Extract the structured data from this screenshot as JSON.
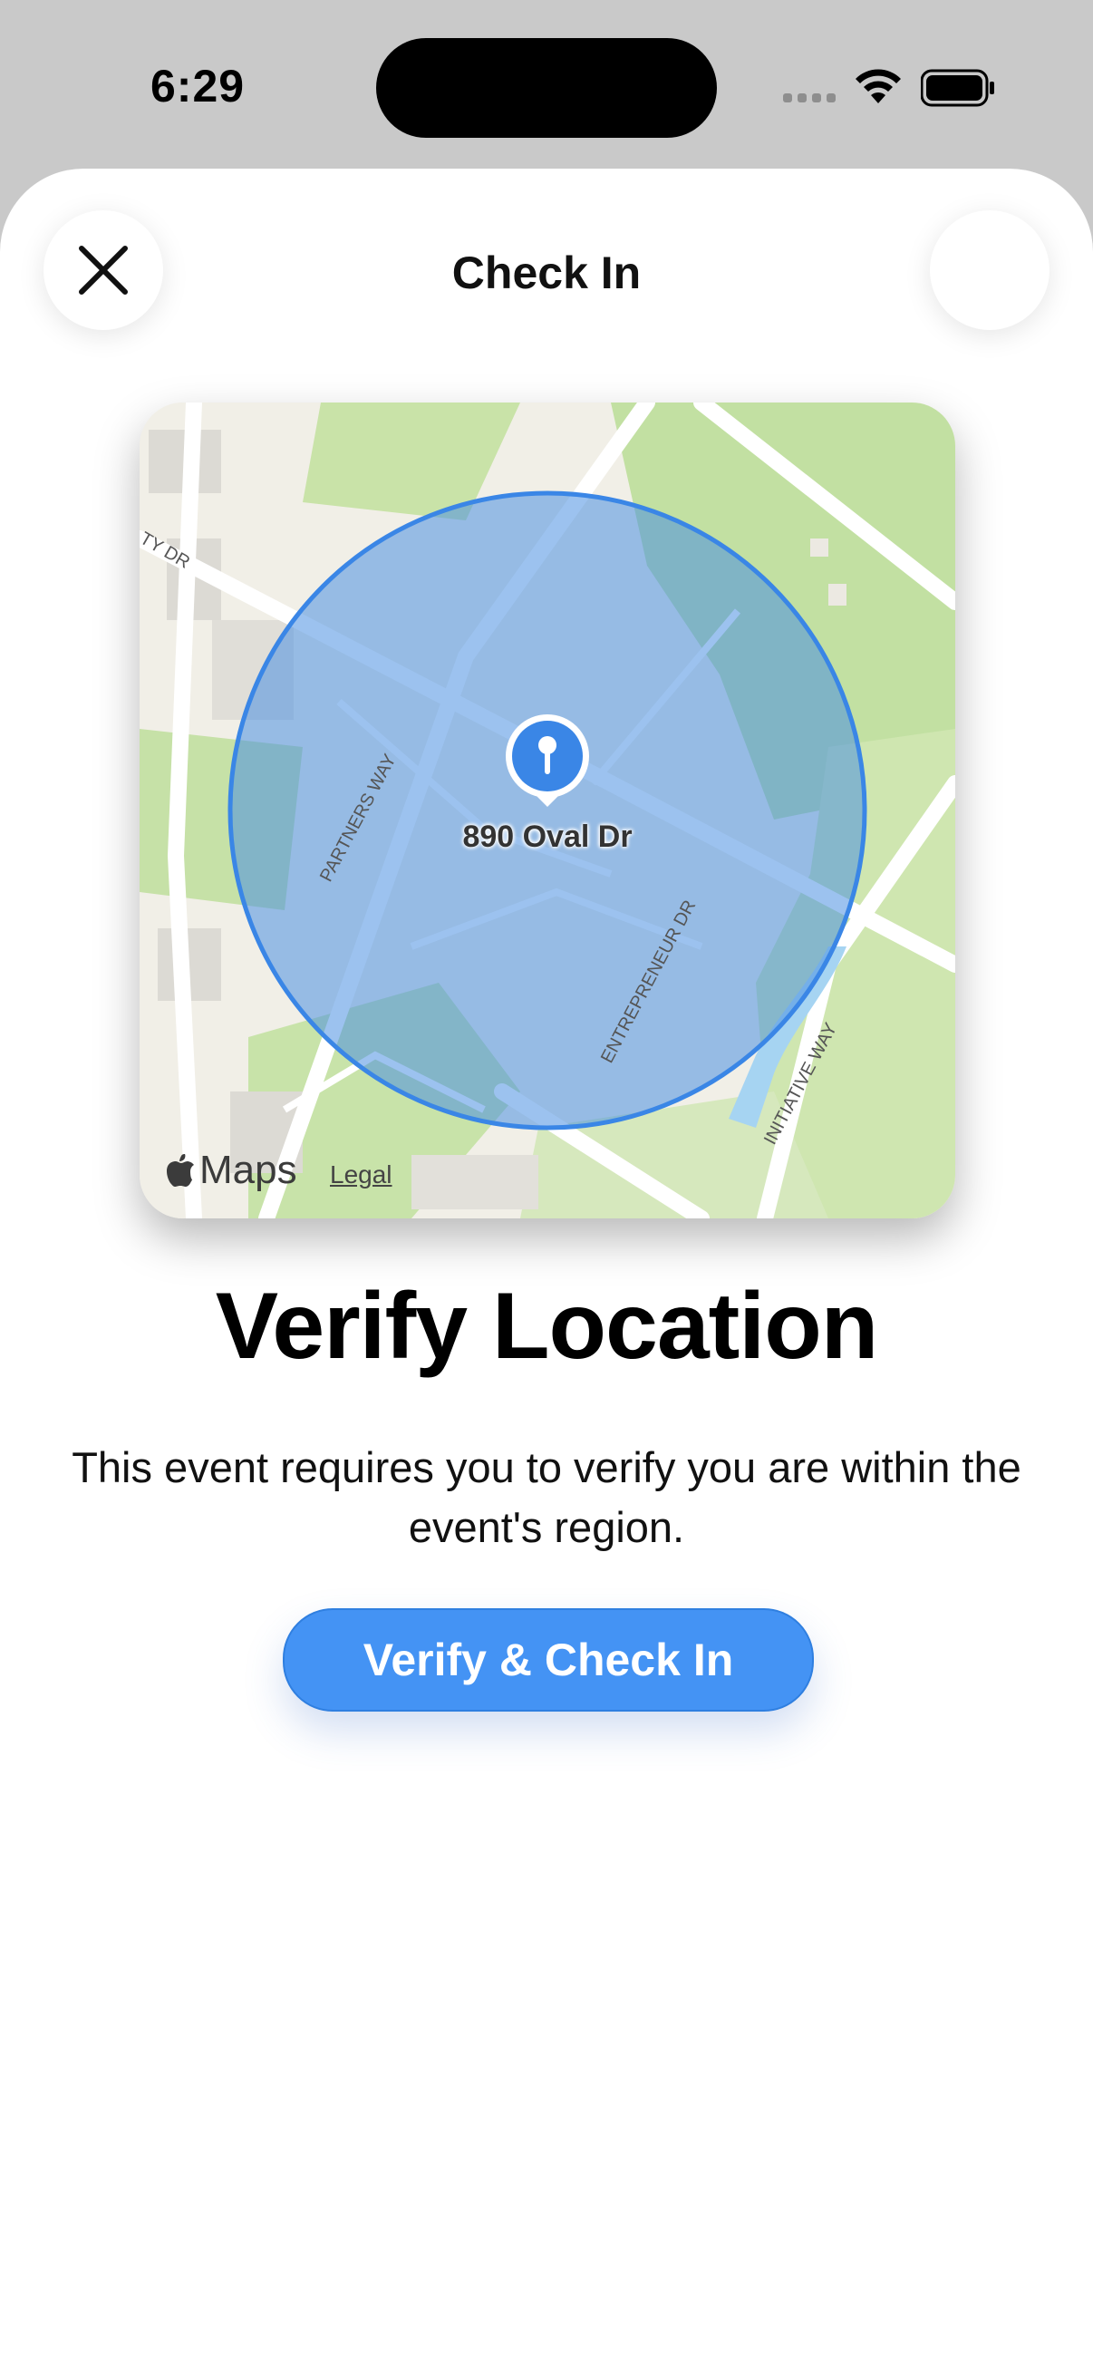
{
  "status_bar": {
    "time": "6:29",
    "icons": [
      "cellular-signal-icon",
      "wifi-icon",
      "battery-icon"
    ]
  },
  "nav": {
    "title": "Check In",
    "close_icon": "close-icon"
  },
  "map": {
    "pin_label": "890 Oval Dr",
    "street_labels": [
      "TY DR",
      "PARTNERS WAY",
      "ENTREPRENEUR DR",
      "INITIATIVE WAY"
    ],
    "attribution": "Maps",
    "legal_link": "Legal",
    "region_color": "#4a90e2"
  },
  "content": {
    "title": "Verify Location",
    "description": "This event requires you to verify you are within the event's region.",
    "button_label": "Verify & Check In"
  },
  "colors": {
    "accent": "#4493f4",
    "sheet_bg": "#ffffff",
    "backdrop": "#c9c9c9"
  }
}
